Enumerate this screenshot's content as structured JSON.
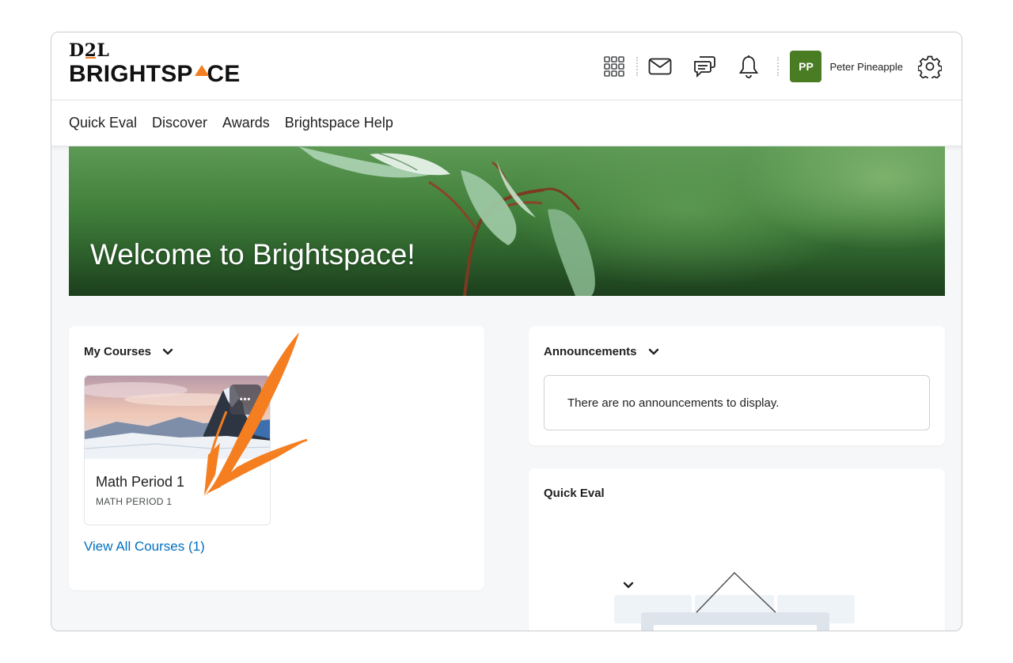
{
  "brand": {
    "line1_a": "D",
    "line1_b": "2",
    "line1_c": "L",
    "line2_a": "BRIGHTSP",
    "line2_b": "^",
    "line2_c": "CE",
    "accent": "#f47e20"
  },
  "header": {
    "icons": [
      "waffle-grid-icon",
      "mail-icon",
      "chat-icon",
      "bell-icon",
      "gear-icon"
    ],
    "user": {
      "initials": "PP",
      "name": "Peter Pineapple",
      "avatar_color": "#4a7c23"
    }
  },
  "nav": {
    "items": [
      "Quick Eval",
      "Discover",
      "Awards",
      "Brightspace Help"
    ]
  },
  "banner": {
    "title": "Welcome to Brightspace!"
  },
  "my_courses": {
    "heading": "My Courses",
    "course": {
      "title": "Math Period 1",
      "code": "MATH PERIOD 1",
      "more_label": "•••"
    },
    "view_all": "View All Courses (1)",
    "link_color": "#006fbf"
  },
  "announcements": {
    "heading": "Announcements",
    "empty_text": "There are no announcements to display."
  },
  "quick_eval": {
    "heading": "Quick Eval"
  },
  "annotation": {
    "arrow_color": "#f47e20"
  }
}
